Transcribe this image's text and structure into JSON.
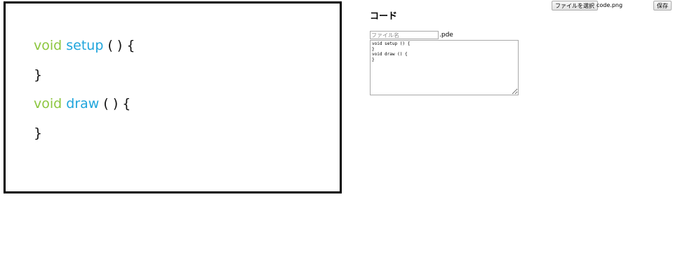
{
  "preview": {
    "lines": [
      {
        "kw": "void",
        "fn": "setup",
        "rest": " ( ) {"
      },
      {
        "kw": "",
        "fn": "",
        "rest": "}"
      },
      {
        "kw": "void",
        "fn": "draw",
        "rest": " ( ) {"
      },
      {
        "kw": "",
        "fn": "",
        "rest": "}"
      }
    ],
    "colors": {
      "void": "#8cc63f",
      "function": "#1fa5dc",
      "frame": "#000000"
    }
  },
  "toolbar": {
    "file_button_label": "ファイルを選択",
    "selected_file": "code.png",
    "save_label": "保存"
  },
  "code_section": {
    "title": "コード",
    "filename_placeholder": "ファイル名",
    "filename_value": "",
    "extension": ".pde",
    "code_text": "void setup () {\n}\nvoid draw () {\n}"
  }
}
